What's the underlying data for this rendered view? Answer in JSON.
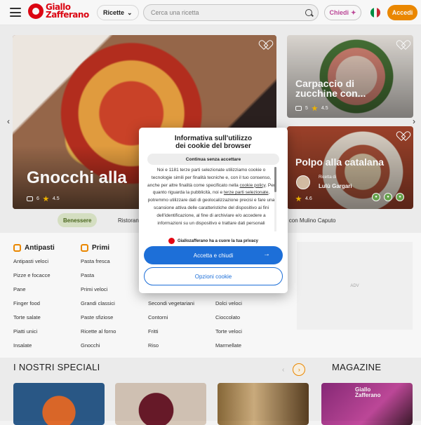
{
  "header": {
    "logo_line1": "Giallo",
    "logo_line2": "Zafferano",
    "category_label": "Ricette",
    "search_placeholder": "Cerca una ricetta",
    "ask_label": "Chiedi",
    "login_label": "Accedi"
  },
  "hero": {
    "title": "Gnocchi alla",
    "comments": "6",
    "rating": "4.5"
  },
  "side_cards": [
    {
      "title_line1": "Carpaccio di",
      "title_line2": "zucchine con...",
      "comments": "5",
      "rating": "4.5"
    },
    {
      "title": "Polpo alla catalana",
      "author_label": "Ricetta di",
      "author": "Lulù Gargari",
      "rating": "4.6"
    }
  ],
  "filters": [
    {
      "label": "Benessere",
      "active": true
    },
    {
      "label": "Ristoran",
      "active": false
    },
    {
      "label": "rea con Mulino Caputo",
      "active": false
    }
  ],
  "categories": {
    "antipasti": {
      "title": "Antipasti",
      "items": [
        "Antipasti veloci",
        "Pizze e focacce",
        "Pane",
        "Finger food",
        "Torte salate",
        "Piatti unici",
        "Insalate"
      ]
    },
    "primi": {
      "title": "Primi",
      "items": [
        "Pasta fresca",
        "Pasta",
        "Primi veloci",
        "Grandi classici",
        "Paste sfiziose",
        "Ricette al forno",
        "Gnocchi"
      ]
    },
    "secondi": {
      "items": [
        "Secondi vegetariani",
        "Contorni",
        "Fritti",
        "Riso"
      ]
    },
    "dolci": {
      "items": [
        "Dolci veloci",
        "Cioccolato",
        "Torte veloci",
        "Marmellate"
      ]
    }
  },
  "adv_label": "ADV",
  "sections": {
    "specials_title": "I NOSTRI SPECIALI",
    "magazine_title": "MAGAZINE",
    "magazine_logo_line1": "Giallo",
    "magazine_logo_line2": "Zafferano"
  },
  "cookie_modal": {
    "title_line1": "Informativa sull'utilizzo",
    "title_line2": "dei cookie del browser",
    "continue_without": "Continua senza accettare",
    "body_start": "Noi e 1181 terze parti selezionate utilizziamo cookie o tecnologie simili per finalità tecniche e, con il tuo consenso, anche per altre finalità come specificato nella ",
    "cookie_policy_link": "cookie policy",
    "body_mid": ". Per quanto riguarda la pubblicità, noi e ",
    "third_parties_link": "terze parti selezionate",
    "body_end": ", potremmo utilizzare dati di geolocalizzazione precisi e fare una scansione attiva delle caratteristiche del dispositivo ai fini dell'identificazione, al fine di archiviare e/o accedere a informazioni su un dispositivo e trattare dati personali",
    "privacy_note": "Giallozafferano ha a cuore la tua privacy",
    "accept_label": "Accetta e chiudi",
    "options_label": "Opzioni cookie"
  },
  "colors": {
    "brand_red": "#e30613",
    "accent_orange": "#f28c00",
    "cta_blue": "#1d6fd8"
  }
}
